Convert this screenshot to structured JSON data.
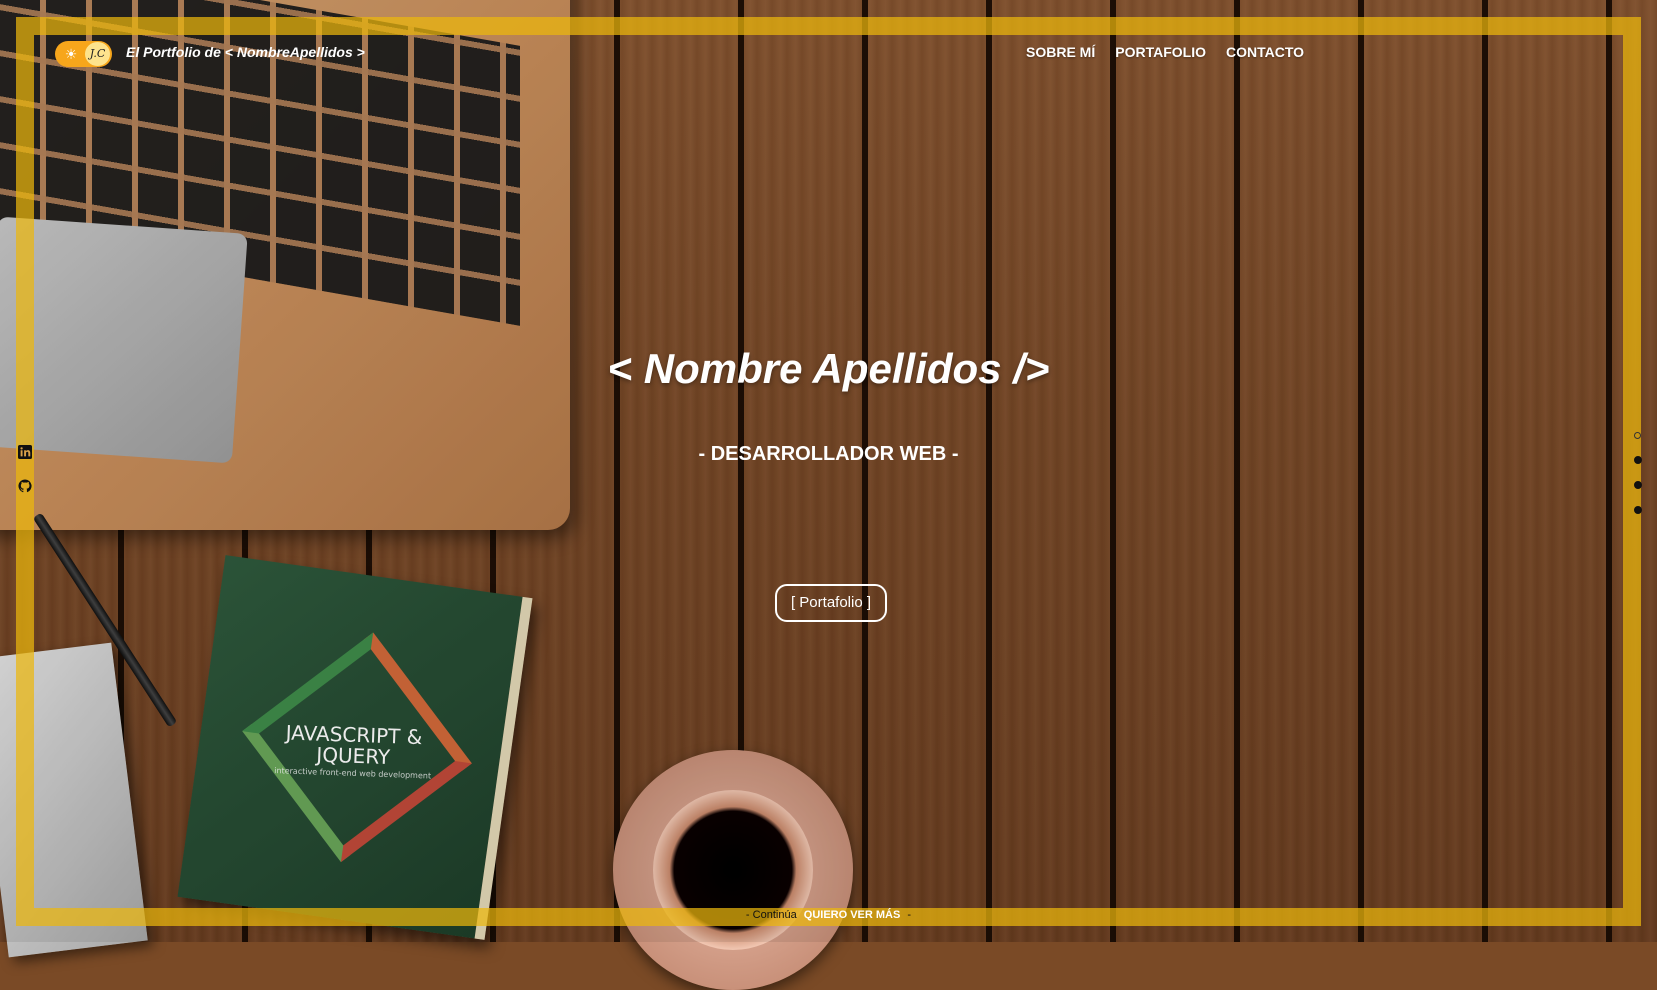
{
  "header": {
    "toggle": {
      "sun_icon": "sun-icon",
      "initials": "J.C"
    },
    "brand": "El Portfolio de < NombreApellidos >",
    "nav": [
      {
        "label": "SOBRE MÍ"
      },
      {
        "label": "PORTAFOLIO"
      },
      {
        "label": "CONTACTO"
      }
    ]
  },
  "hero": {
    "title": "< Nombre Apellidos />",
    "subtitle": "- DESARROLLADOR WEB -",
    "button": "[ Portafolio ]"
  },
  "background": {
    "book_title": "JAVASCRIPT & JQUERY",
    "book_sub": "interactive front-end web development"
  },
  "social": [
    {
      "icon": "linkedin-icon"
    },
    {
      "icon": "github-icon"
    }
  ],
  "footer": {
    "prefix": "-",
    "lead": "Continúa",
    "cta": "QUIERO VER MÁS",
    "suffix": "-"
  },
  "colors": {
    "frame": "#ecb70d",
    "toggle": "#f7a61b",
    "knob": "#fde38d"
  }
}
